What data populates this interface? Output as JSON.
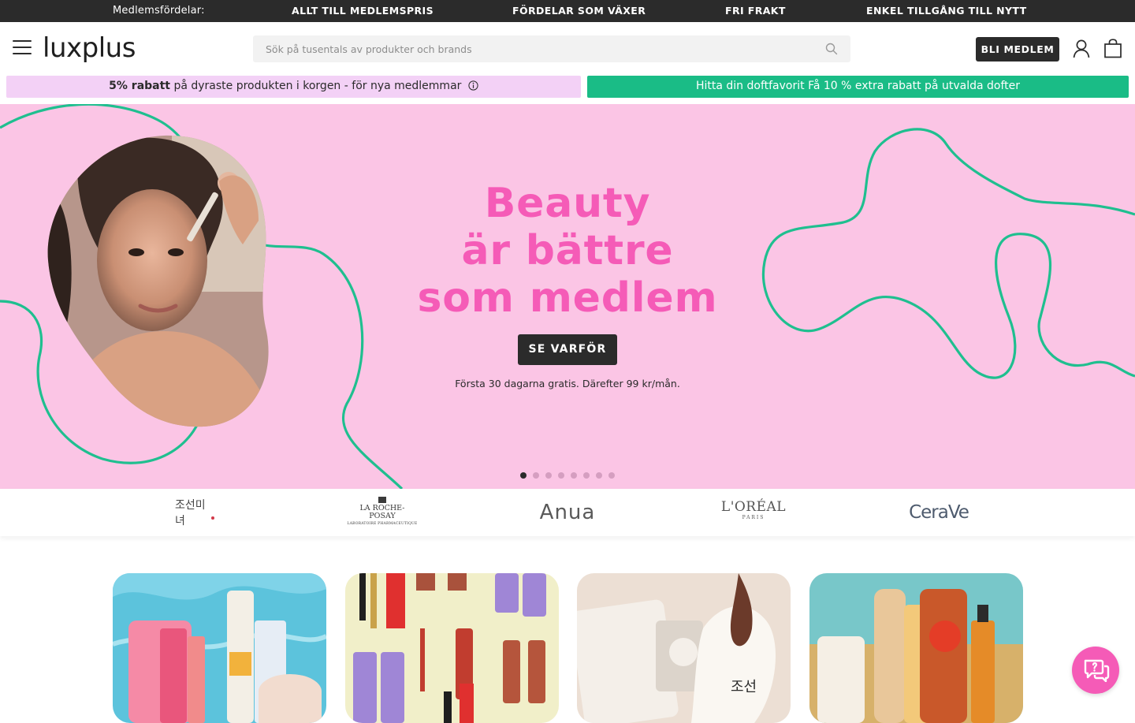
{
  "benefits_bar": {
    "label": "Medlemsfördelar:",
    "items": [
      "ALLT TILL MEDLEMSPRIS",
      "FÖRDELAR SOM VÄXER",
      "FRI FRAKT",
      "ENKEL TILLGÅNG TILL NYTT"
    ]
  },
  "header": {
    "logo": "luxplus",
    "search_placeholder": "Sök på tusentals av produkter och brands",
    "member_button": "BLI MEDLEM",
    "icons": [
      "menu-icon",
      "search-icon",
      "user-icon",
      "bag-icon"
    ]
  },
  "promos": {
    "left_bold": "5% rabatt",
    "left_rest": " på dyraste produkten i korgen - för nya medlemmar",
    "right": "Hitta din doftfavorit  Få 10 % extra rabatt på utvalda dofter"
  },
  "hero": {
    "title_lines": [
      "Beauty",
      "är bättre",
      "som medlem"
    ],
    "cta": "SE VARFÖR",
    "subtext": "Första 30 dagarna gratis. Därefter 99 kr/mån.",
    "slide_count": 8,
    "active_slide": 1
  },
  "brands": {
    "beauty_of_joseon": "조선미녀",
    "la_roche_posay": "LA ROCHE-POSAY",
    "la_roche_posay_sub": "LABORATOIRE PHARMACEUTIQUE",
    "anua": "Anua",
    "loreal": "L'ORÉAL",
    "loreal_sub": "PARIS",
    "cerave": "CeraVe"
  },
  "colors": {
    "dark": "#2b2b2b",
    "hero_bg": "#fbc5e5",
    "hero_title": "#f55bb7",
    "swirl": "#1fbf8f",
    "promo_left_bg": "#f3d1f6",
    "promo_right_bg": "#1abc86"
  }
}
